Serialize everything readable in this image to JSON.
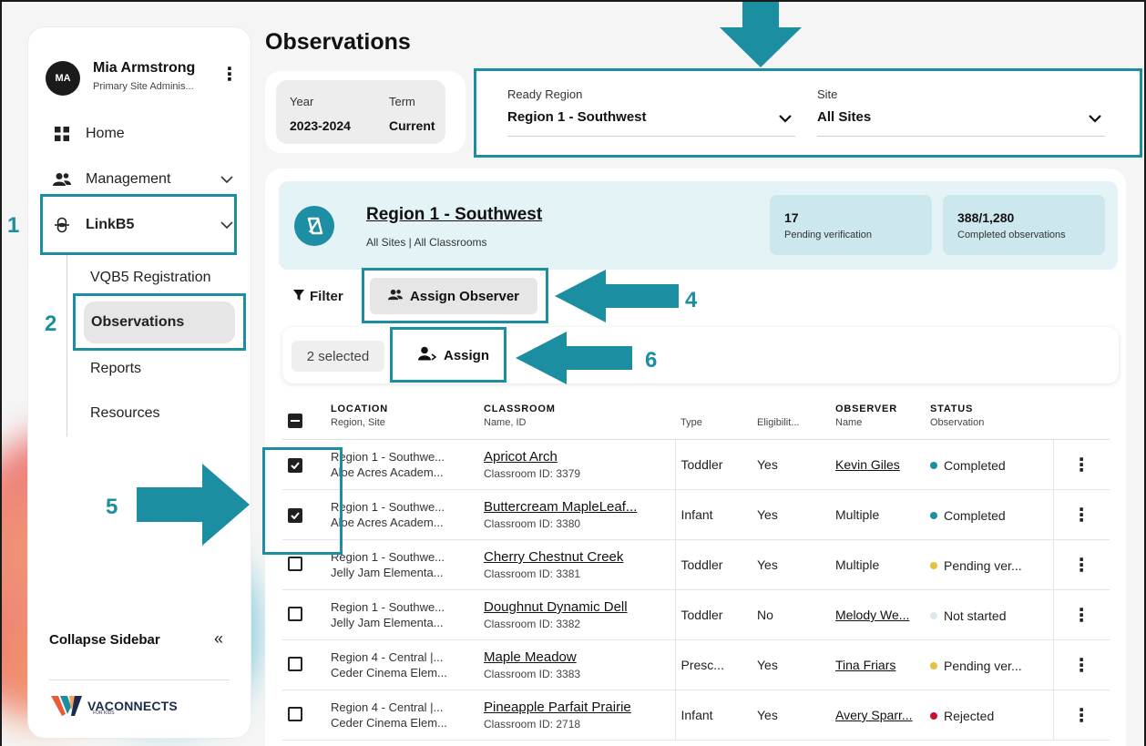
{
  "user": {
    "initials": "MA",
    "name": "Mia Armstrong",
    "role": "Primary Site Adminis..."
  },
  "nav": {
    "home": "Home",
    "management": "Management",
    "linkb5": "LinkB5",
    "sub": [
      "VQB5 Registration",
      "Observations",
      "Reports",
      "Resources"
    ],
    "collapse": "Collapse Sidebar"
  },
  "logo": {
    "name": "VACONNECTS",
    "tagline": "FOR KIDS"
  },
  "page": {
    "title": "Observations"
  },
  "period": {
    "year_label": "Year",
    "year_value": "2023-2024",
    "term_label": "Term",
    "term_value": "Current"
  },
  "filters": {
    "region_label": "Ready Region",
    "region_value": "Region 1 - Southwest",
    "site_label": "Site",
    "site_value": "All Sites"
  },
  "region": {
    "name": "Region 1 - Southwest",
    "scope": "All Sites | All Classrooms",
    "pending_count": "17",
    "pending_label": "Pending verification",
    "completed_count": "388/1,280",
    "completed_label": "Completed observations"
  },
  "toolbar": {
    "filter": "Filter",
    "assign_observer": "Assign Observer"
  },
  "selection": {
    "count": "2 selected",
    "assign": "Assign"
  },
  "table": {
    "headers": {
      "location": "LOCATION",
      "location_sub": "Region, Site",
      "classroom": "CLASSROOM",
      "classroom_sub": "Name, ID",
      "type": "Type",
      "eligibility": "Eligibilit...",
      "observer": "OBSERVER",
      "observer_sub": "Name",
      "status": "STATUS",
      "status_sub": "Observation"
    },
    "rows": [
      {
        "checked": true,
        "region": "Region 1 - Southwe...",
        "site": "Aloe Acres Academ...",
        "classroom": "Apricot Arch",
        "class_id": "Classroom ID: 3379",
        "type": "Toddler",
        "eligible": "Yes",
        "observer": "Kevin Giles",
        "observer_link": true,
        "status": "Completed",
        "status_color": "#1b8ea2"
      },
      {
        "checked": true,
        "region": "Region 1 - Southwe...",
        "site": "Aloe Acres Academ...",
        "classroom": "Buttercream MapleLeaf...",
        "class_id": "Classroom ID: 3380",
        "type": "Infant",
        "eligible": "Yes",
        "observer": "Multiple",
        "observer_link": false,
        "status": "Completed",
        "status_color": "#1b8ea2"
      },
      {
        "checked": false,
        "region": "Region 1 - Southwe...",
        "site": "Jelly Jam Elementa...",
        "classroom": "Cherry Chestnut Creek",
        "class_id": "Classroom ID: 3381",
        "type": "Toddler",
        "eligible": "Yes",
        "observer": "Multiple",
        "observer_link": false,
        "status": "Pending ver...",
        "status_color": "#e6c13c"
      },
      {
        "checked": false,
        "region": "Region 1 - Southwe...",
        "site": "Jelly Jam Elementa...",
        "classroom": "Doughnut Dynamic Dell",
        "class_id": "Classroom ID: 3382",
        "type": "Toddler",
        "eligible": "No",
        "observer": "Melody We...",
        "observer_link": true,
        "status": "Not started",
        "status_color": "#dde8ee"
      },
      {
        "checked": false,
        "region": "Region 4 - Central |...",
        "site": "Ceder Cinema Elem...",
        "classroom": "Maple Meadow",
        "class_id": "Classroom ID: 3383",
        "type": "Presc...",
        "eligible": "Yes",
        "observer": "Tina Friars",
        "observer_link": true,
        "status": "Pending ver...",
        "status_color": "#e6c13c"
      },
      {
        "checked": false,
        "region": "Region 4 - Central |...",
        "site": "Ceder Cinema Elem...",
        "classroom": "Pineapple Parfait Prairie",
        "class_id": "Classroom ID: 2718",
        "type": "Infant",
        "eligible": "Yes",
        "observer": "Avery Sparr...",
        "observer_link": true,
        "status": "Rejected",
        "status_color": "#c8102e"
      }
    ]
  },
  "callouts": [
    "1",
    "2",
    "4",
    "5",
    "6"
  ],
  "colors": {
    "accent": "#1b8ea2",
    "banner": "#e3f3f6"
  }
}
